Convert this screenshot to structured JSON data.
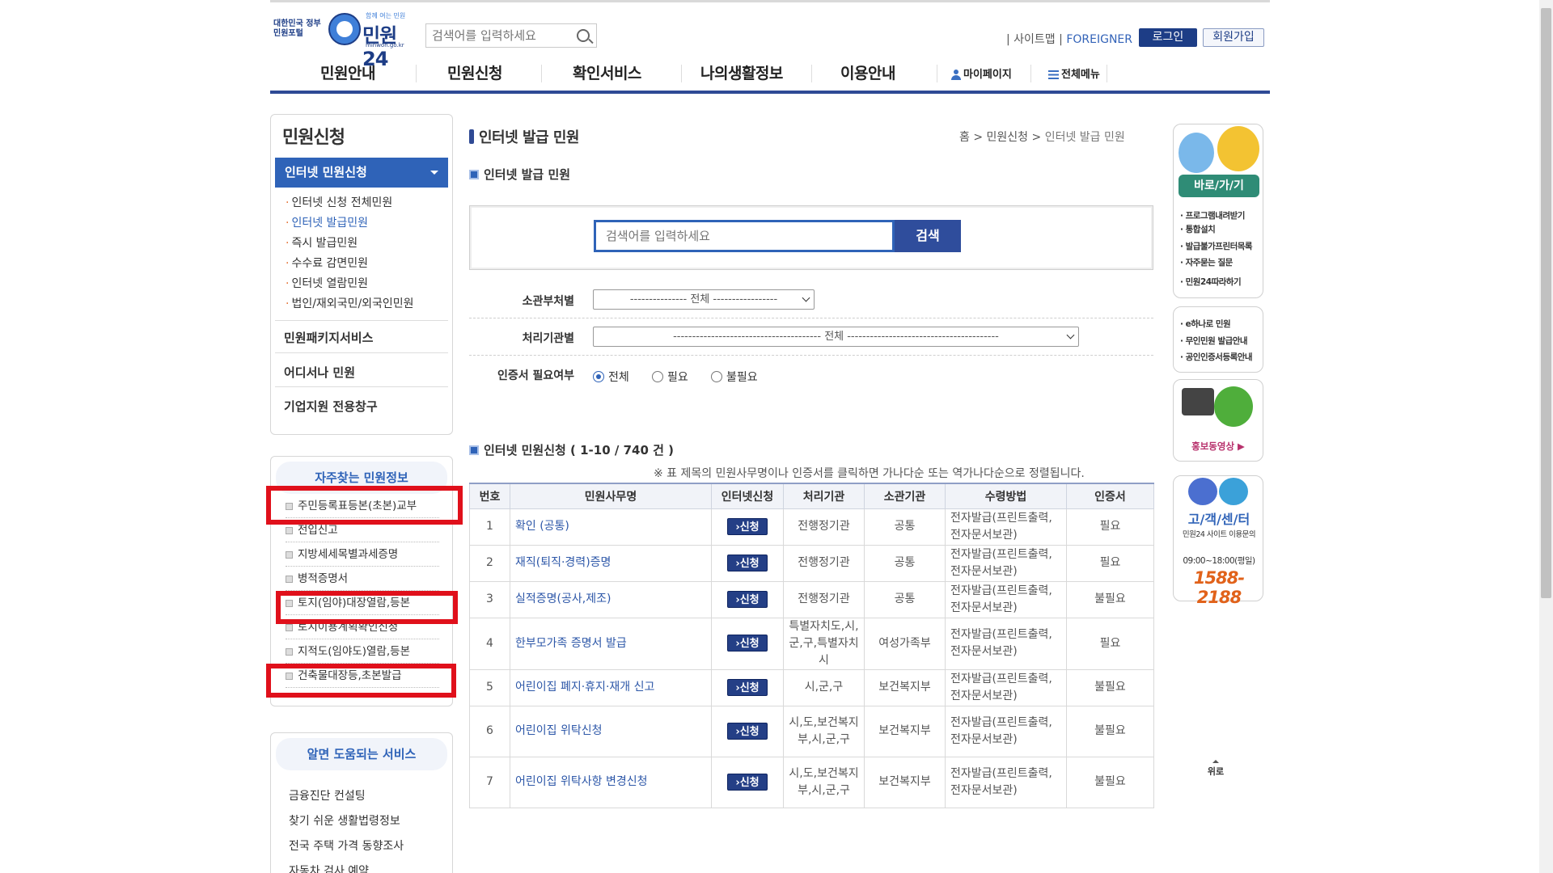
{
  "header": {
    "gov_label": "대한민국 정부민원포털",
    "slogan": "함께 여는 민원",
    "brand": "민원24",
    "domain": "minwon.go.kr",
    "search_placeholder": "검색어를 입력하세요",
    "sitemap": "사이트맵",
    "foreigner": "FOREIGNER",
    "login": "로그인",
    "join": "회원가입"
  },
  "gnb": {
    "items": [
      "민원안내",
      "민원신청",
      "확인서비스",
      "나의생활정보",
      "이용안내"
    ],
    "mypage": "마이페이지",
    "allmenu": "전체메뉴"
  },
  "lnb": {
    "title": "민원신청",
    "active": "인터넷 민원신청",
    "subs": [
      "인터넷 신청 전체민원",
      "인터넷 발급민원",
      "즉시 발급민원",
      "수수료 감면민원",
      "인터넷 열람민원",
      "법인/재외국민/외국인민원"
    ],
    "mains": [
      "민원패키지서비스",
      "어디서나 민원",
      "기업지원 전용창구"
    ]
  },
  "faq": {
    "title": "자주찾는 민원정보",
    "items": [
      "주민등록표등본(초본)교부",
      "전입신고",
      "지방세세목별과세증명",
      "병적증명서",
      "토지(임야)대장열람,등본",
      "토지이용계획확인신청",
      "지적도(임야도)열람,등본",
      "건축물대장등,초본발급"
    ]
  },
  "help": {
    "title": "알면 도움되는 서비스",
    "items": [
      "금융진단 컨설팅",
      "찾기 쉬운 생활법령정보",
      "전국 주택 가격 동향조사",
      "자동차 검사 예약"
    ]
  },
  "main": {
    "page_title": "인터넷 발급 민원",
    "breadcrumb": {
      "home": "홈",
      "level1": "민원신청",
      "current": "인터넷 발급 민원"
    },
    "sub_title": "인터넷 발급 민원",
    "search_placeholder": "검색어를 입력하세요",
    "search_button": "검색",
    "filter_dept_label": "소관부처별",
    "filter_dept_value": "--------------- 전체 -----------------",
    "filter_org_label": "처리기관별",
    "filter_org_value": "--------------------------------------- 전체 ----------------------------------------",
    "cert_label": "인증서 필요여부",
    "cert_options": [
      "전체",
      "필요",
      "불필요"
    ],
    "list_title": "인터넷 민원신청 ( 1-10 / 740 건 )",
    "list_note": "※ 표 제목의 민원사무명이나 인증서를 클릭하면 가나다순 또는 역가나다순으로 정렬됩니다."
  },
  "table": {
    "headers": [
      "번호",
      "민원사무명",
      "인터넷신청",
      "처리기관",
      "소관기관",
      "수령방법",
      "인증서"
    ],
    "apply_label": "›신청",
    "rows": [
      {
        "no": "1",
        "name": "확인 (공통)",
        "org": "전행정기관",
        "dept": "공통",
        "method": "전자발급(프린트출력, 전자문서보관)",
        "cert": "필요"
      },
      {
        "no": "2",
        "name": "재직(퇴직·경력)증명",
        "org": "전행정기관",
        "dept": "공통",
        "method": "전자발급(프린트출력, 전자문서보관)",
        "cert": "필요"
      },
      {
        "no": "3",
        "name": "실적증명(공사,제조)",
        "org": "전행정기관",
        "dept": "공통",
        "method": "전자발급(프린트출력, 전자문서보관)",
        "cert": "불필요"
      },
      {
        "no": "4",
        "name": "한부모가족 증명서 발급",
        "org": "특별자치도,시,군,구,특별자치시",
        "dept": "여성가족부",
        "method": "전자발급(프린트출력, 전자문서보관)",
        "cert": "필요"
      },
      {
        "no": "5",
        "name": "어린이집 폐지·휴지·재개 신고",
        "org": "시,군,구",
        "dept": "보건복지부",
        "method": "전자발급(프린트출력, 전자문서보관)",
        "cert": "불필요"
      },
      {
        "no": "6",
        "name": "어린이집 위탁신청",
        "org": "시,도,보건복지부,시,군,구",
        "dept": "보건복지부",
        "method": "전자발급(프린트출력, 전자문서보관)",
        "cert": "불필요"
      },
      {
        "no": "7",
        "name": "어린이집 위탁사항 변경신청",
        "org": "시,도,보건복지부,시,군,구",
        "dept": "보건복지부",
        "method": "전자발급(프린트출력, 전자문서보관)",
        "cert": "불필요"
      }
    ]
  },
  "quick": {
    "shortcut_title": "바로/가/기",
    "shortcut_links": [
      "· 프로그램내려받기",
      "· 통합설치",
      "· 발급불가프린터목록",
      "· 자주묻는 질문",
      "· 민원24따라하기"
    ],
    "service_links": [
      "· e하나로 민원",
      "· 무인민원 발급안내",
      "· 공인인증서등록안내"
    ],
    "video_label": "홍보동영상 ▶",
    "cs_title": "고/객/센/터",
    "cs_sub": "민원24 사이트 이용문의",
    "cs_hours": "09:00~18:00(평일)",
    "cs_phone": "1588-2188",
    "top_label": "위로"
  },
  "colors": {
    "brand_navy": "#1d3d86",
    "accent_blue": "#2f63b8",
    "highlight_red": "#e0101b"
  }
}
